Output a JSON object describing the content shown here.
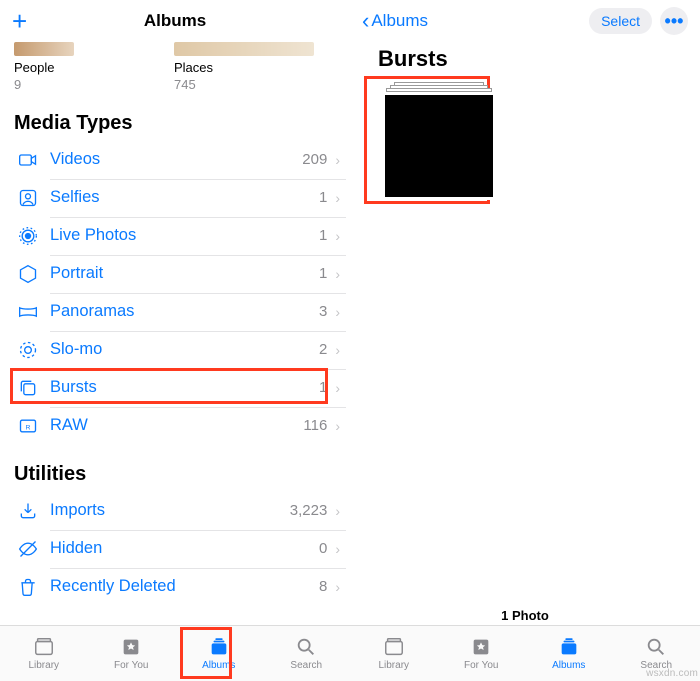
{
  "left": {
    "headerTitle": "Albums",
    "thumb1": {
      "label": "People",
      "count": "9"
    },
    "thumb2": {
      "label": "Places",
      "count": "745"
    },
    "sectionMedia": "Media Types",
    "sectionUtil": "Utilities",
    "media": [
      {
        "name": "videos",
        "label": "Videos",
        "count": "209"
      },
      {
        "name": "selfies",
        "label": "Selfies",
        "count": "1"
      },
      {
        "name": "livephotos",
        "label": "Live Photos",
        "count": "1"
      },
      {
        "name": "portrait",
        "label": "Portrait",
        "count": "1"
      },
      {
        "name": "panoramas",
        "label": "Panoramas",
        "count": "3"
      },
      {
        "name": "slomo",
        "label": "Slo-mo",
        "count": "2"
      },
      {
        "name": "bursts",
        "label": "Bursts",
        "count": "1"
      },
      {
        "name": "raw",
        "label": "RAW",
        "count": "116"
      }
    ],
    "util": [
      {
        "name": "imports",
        "label": "Imports",
        "count": "3,223"
      },
      {
        "name": "hidden",
        "label": "Hidden",
        "count": "0"
      },
      {
        "name": "deleted",
        "label": "Recently Deleted",
        "count": "8"
      }
    ],
    "tabs": {
      "library": "Library",
      "foryou": "For You",
      "albums": "Albums",
      "search": "Search"
    }
  },
  "right": {
    "backLabel": "Albums",
    "selectLabel": "Select",
    "title": "Bursts",
    "footer": "1 Photo",
    "tabs": {
      "library": "Library",
      "foryou": "For You",
      "albums": "Albums",
      "search": "Search"
    }
  },
  "watermark": "wsxdn.com"
}
